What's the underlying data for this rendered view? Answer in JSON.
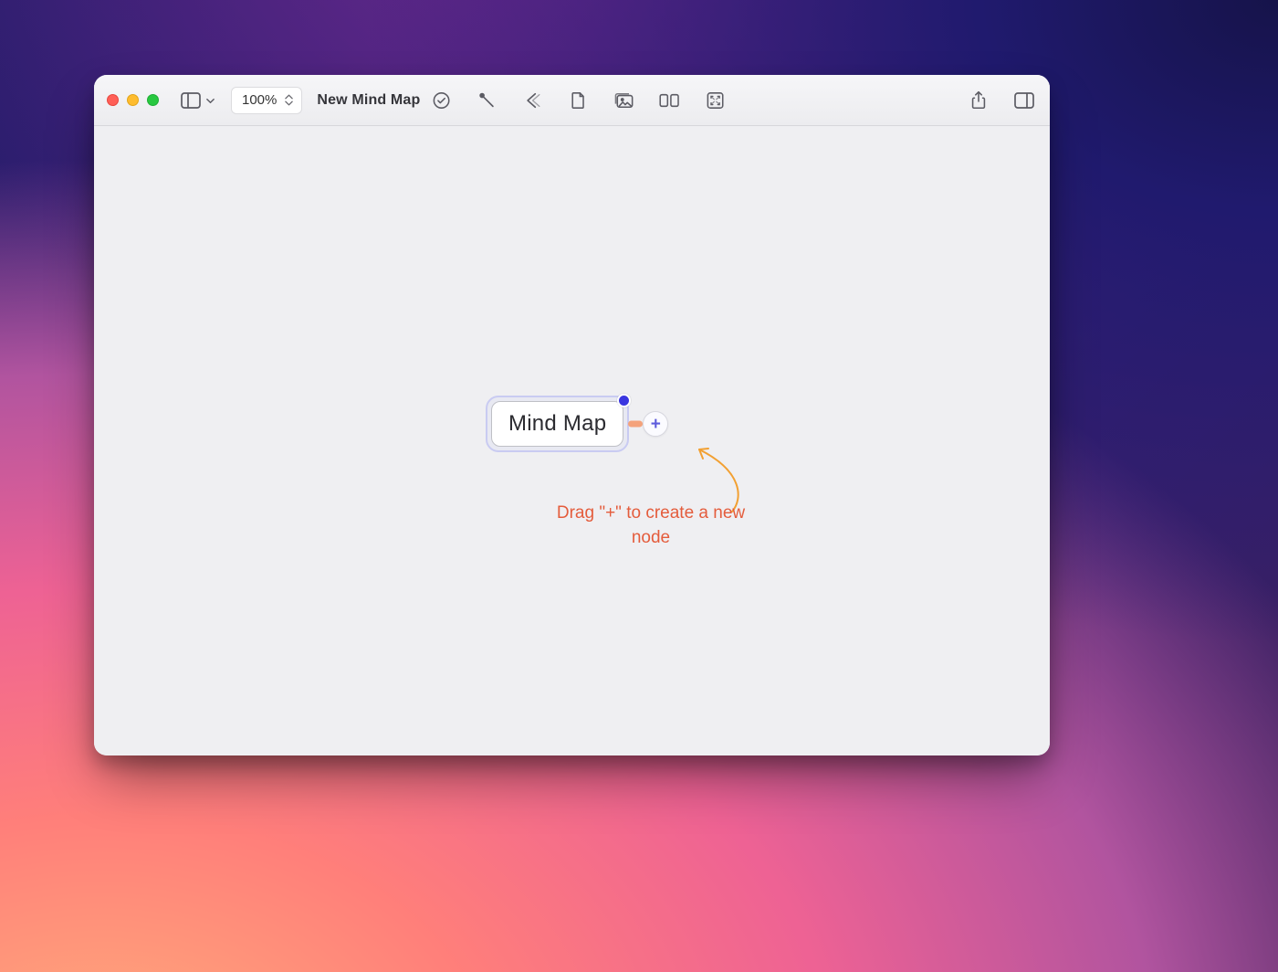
{
  "toolbar": {
    "zoom_label": "100%",
    "title": "New Mind Map"
  },
  "canvas": {
    "root_label": "Mind Map",
    "add_glyph": "+",
    "hint_text": "Drag \"+\" to create a new node"
  },
  "icons": {
    "sidebar": "sidebar-icon",
    "check": "check-circle-icon",
    "connection": "connection-line-icon",
    "back": "back-chevron-icon",
    "note": "note-document-icon",
    "image": "image-stack-icon",
    "layout": "layout-grid-icon",
    "fullscreen": "fullscreen-icon",
    "share": "share-icon",
    "inspector": "inspector-panel-icon"
  }
}
